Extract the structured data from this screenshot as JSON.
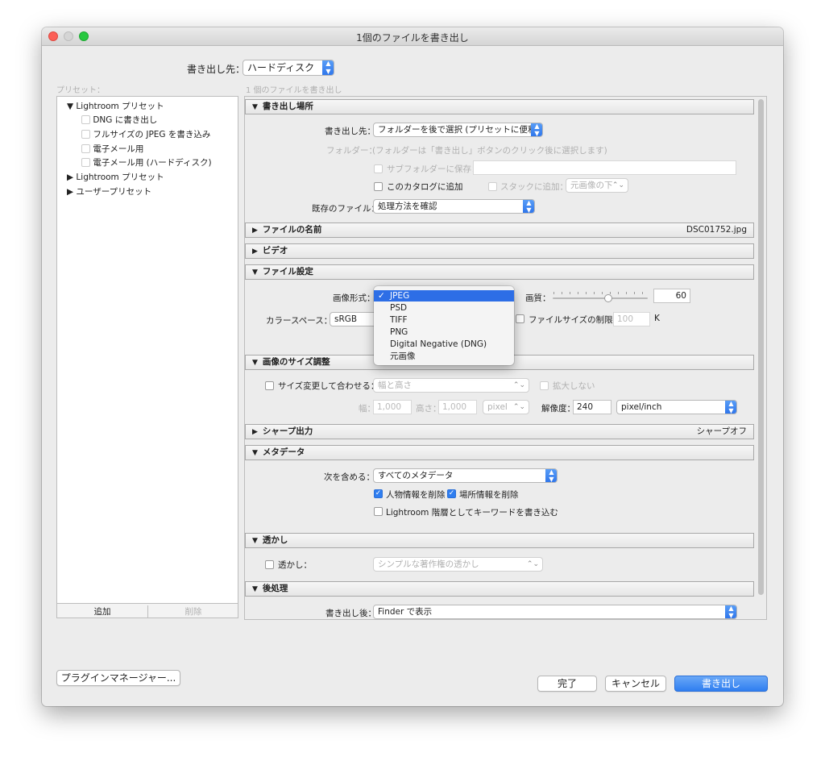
{
  "window": {
    "title": "1個のファイルを書き出し"
  },
  "top": {
    "export_to_label": "書き出し先：",
    "export_to_value": "ハードディスク"
  },
  "sidebar": {
    "presets_label": "プリセット：",
    "tree": [
      {
        "label": "Lightroom プリセット",
        "type": "group-open"
      },
      {
        "label": "DNG に書き出し",
        "type": "item"
      },
      {
        "label": "フルサイズの JPEG を書き込み",
        "type": "item"
      },
      {
        "label": "電子メール用",
        "type": "item"
      },
      {
        "label": "電子メール用 (ハードディスク)",
        "type": "item"
      },
      {
        "label": "Lightroom プリセット",
        "type": "group-closed"
      },
      {
        "label": "ユーザープリセット",
        "type": "group-closed"
      }
    ],
    "add_button": "追加",
    "remove_button": "削除"
  },
  "main": {
    "subtitle": "1 個のファイルを書き出し"
  },
  "export_location": {
    "header": "書き出し場所",
    "export_to_label": "書き出し先：",
    "export_to_value": "フォルダーを後で選択 (プリセットに便利)",
    "folder_label": "フォルダー：",
    "folder_value": "(フォルダーは「書き出し」ボタンのクリック後に選択します)",
    "subfolder_label": "サブフォルダーに保存：",
    "add_to_catalog_label": "このカタログに追加",
    "add_to_stack_label": "スタックに追加：",
    "stack_value": "元画像の下",
    "existing_files_label": "既存のファイル：",
    "existing_files_value": "処理方法を確認"
  },
  "file_naming": {
    "header": "ファイルの名前",
    "right": "DSC01752.jpg"
  },
  "video": {
    "header": "ビデオ"
  },
  "file_settings": {
    "header": "ファイル設定",
    "format_label": "画像形式：",
    "format_options": [
      "JPEG",
      "PSD",
      "TIFF",
      "PNG",
      "Digital Negative (DNG)",
      "元画像"
    ],
    "format_selected": "JPEG",
    "check_mark": "✓",
    "quality_label": "画質：",
    "quality_value": "60",
    "color_space_label": "カラースペース：",
    "color_space_value": "sRGB",
    "limit_size_label": "ファイルサイズの制限：",
    "limit_size_value": "100",
    "limit_size_unit": "K"
  },
  "image_sizing": {
    "header": "画像のサイズ調整",
    "resize_label": "サイズ変更して合わせる：",
    "resize_value": "幅と高さ",
    "dont_enlarge_label": "拡大しない",
    "width_label": "幅：",
    "width_value": "1,000",
    "height_label": "高さ：",
    "height_value": "1,000",
    "unit_value": "pixel",
    "resolution_label": "解像度：",
    "resolution_value": "240",
    "resolution_unit": "pixel/inch"
  },
  "sharpening": {
    "header": "シャープ出力",
    "right": "シャープオフ"
  },
  "metadata": {
    "header": "メタデータ",
    "include_label": "次を含める：",
    "include_value": "すべてのメタデータ",
    "remove_person_label": "人物情報を削除",
    "remove_location_label": "場所情報を削除",
    "keywords_label": "Lightroom 階層としてキーワードを書き込む"
  },
  "watermark": {
    "header": "透かし",
    "watermark_label": "透かし：",
    "watermark_value": "シンプルな著作権の透かし"
  },
  "post_processing": {
    "header": "後処理",
    "after_export_label": "書き出し後：",
    "after_export_value": "Finder で表示"
  },
  "footer": {
    "plugin_manager": "プラグインマネージャー...",
    "done": "完了",
    "cancel": "キャンセル",
    "export": "書き出し"
  },
  "colors": {
    "accent": "#2f7ef0",
    "close": "#fc5f57",
    "minimize": "#fdbc2e",
    "zoom": "#28c840"
  }
}
